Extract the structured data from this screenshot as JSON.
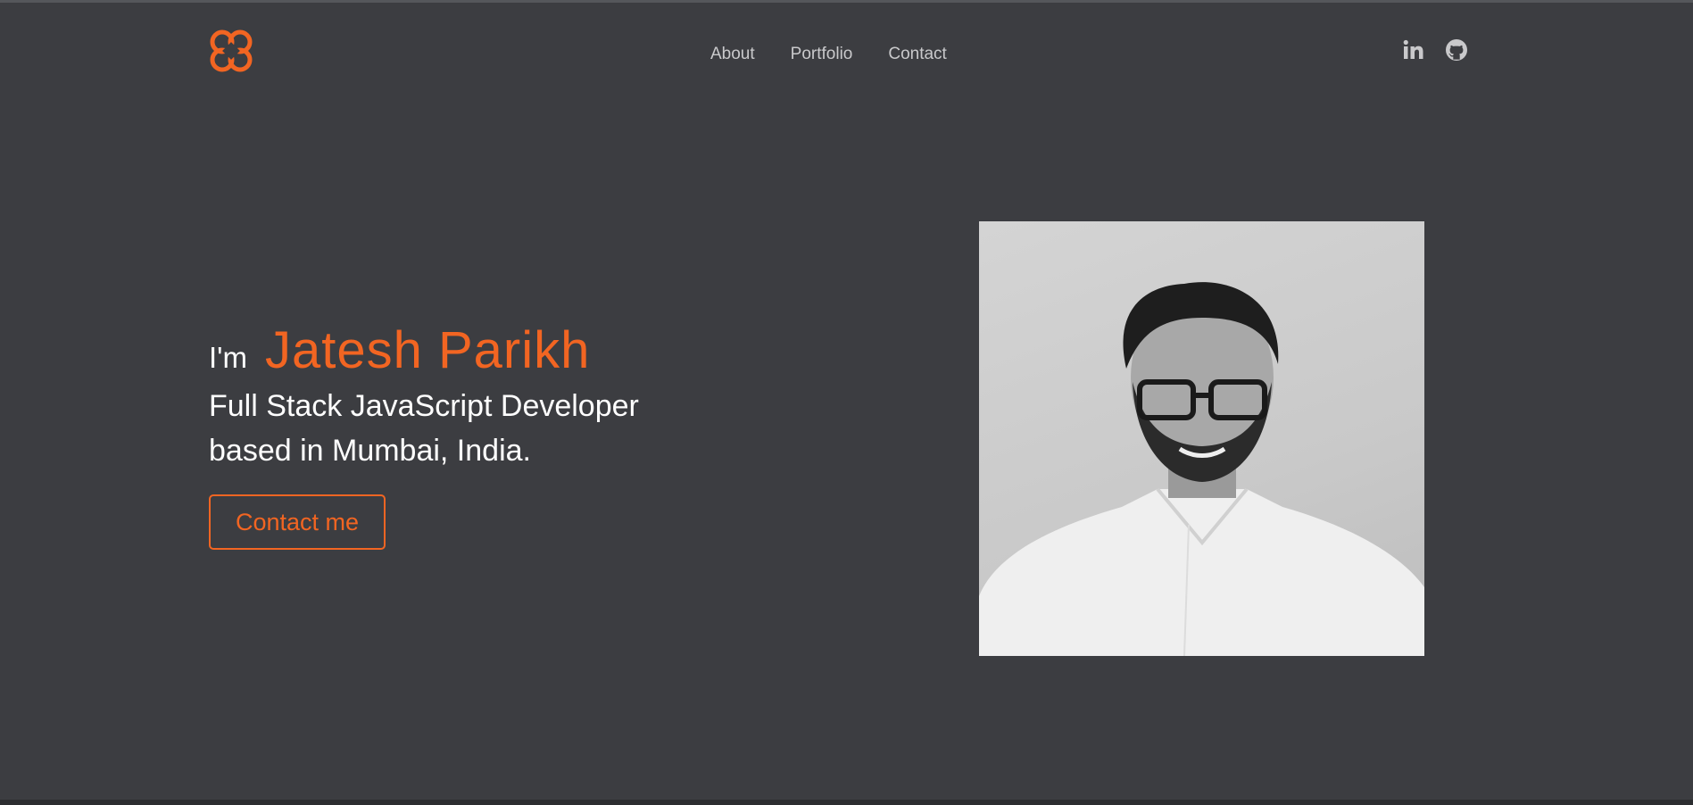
{
  "header": {
    "logo_icon": "flower-knot-logo-icon",
    "nav": [
      {
        "label": "About"
      },
      {
        "label": "Portfolio"
      },
      {
        "label": "Contact"
      }
    ],
    "social": [
      {
        "icon": "linkedin-icon"
      },
      {
        "icon": "github-icon"
      }
    ]
  },
  "hero": {
    "prefix": "I'm",
    "name": "Jatesh Parikh",
    "tagline_line1": "Full Stack JavaScript Developer",
    "tagline_line2": "based in Mumbai, India.",
    "cta_label": "Contact me",
    "photo": "portrait-photo"
  },
  "colors": {
    "background": "#3c3d41",
    "accent": "#f26522",
    "nav_text": "#c9c9cb",
    "text": "#ffffff"
  }
}
